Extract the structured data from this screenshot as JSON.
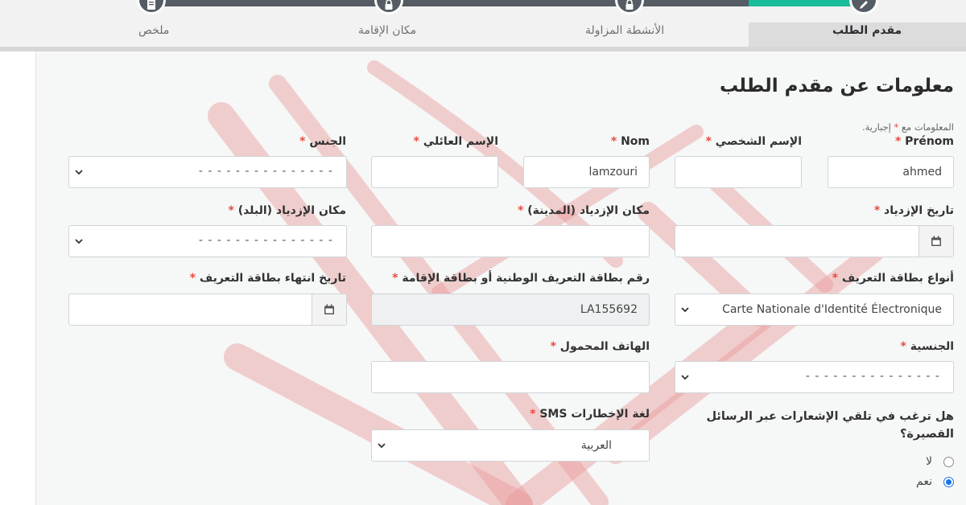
{
  "stepper": {
    "steps": [
      {
        "label": "مقدم الطلب",
        "icon": "pencil-icon",
        "active": true
      },
      {
        "label": "الأنشطة المزاولة",
        "icon": "lock-icon",
        "active": false
      },
      {
        "label": "مكان الإقامة",
        "icon": "lock-icon",
        "active": false
      },
      {
        "label": "ملخص",
        "icon": "document-icon",
        "active": false
      }
    ]
  },
  "form": {
    "title": "معلومات عن مقدم الطلب",
    "required_note_prefix": "المعلومات مع",
    "required_star": "*",
    "required_note_suffix": "إجبارية.",
    "fields": {
      "prenom": {
        "label": "Prénom",
        "value": "ahmed"
      },
      "prenom_ar": {
        "label": "الإسم الشخصي",
        "value": ""
      },
      "nom": {
        "label": "Nom",
        "value": "lamzouri"
      },
      "nom_ar": {
        "label": "الإسم العائلي",
        "value": ""
      },
      "sexe": {
        "label": "الجنس",
        "value": "- - - - - - - - - - - - - - -"
      },
      "birth_date": {
        "label": "تاريخ الإزدياد",
        "value": ""
      },
      "birth_city": {
        "label": "مكان الإزدياد (المدينة)",
        "value": ""
      },
      "birth_country": {
        "label": "مكان الإزدياد (البلد)",
        "value": "- - - - - - - - - - - - - - -"
      },
      "id_type": {
        "label": "أنواع بطاقة التعريف",
        "value": "Carte Nationale d'Identité Électronique"
      },
      "id_number": {
        "label": "رقم بطاقة التعريف الوطنية أو بطاقة الإقامة",
        "value": "LA155692"
      },
      "id_expiry": {
        "label": "تاريخ انتهاء بطاقة التعريف",
        "value": ""
      },
      "nationality": {
        "label": "الجنسية",
        "value": "- - - - - - - - - - - - - - -"
      },
      "mobile": {
        "label": "الهاتف المحمول",
        "value": ""
      },
      "sms_lang": {
        "label": "لغة الإخطارات SMS",
        "value": "العربية"
      }
    },
    "sms_question": "هل ترغب في تلقي الإشعارات عبر الرسائل القصيرة؟",
    "sms_options": [
      {
        "label": "لا",
        "checked": false
      },
      {
        "label": "نعم",
        "checked": true
      }
    ]
  },
  "colors": {
    "accent": "#1abc9c",
    "stepper_dark": "#555c63",
    "required": "#e74c3c",
    "radio_checked": "#1a73e8"
  }
}
